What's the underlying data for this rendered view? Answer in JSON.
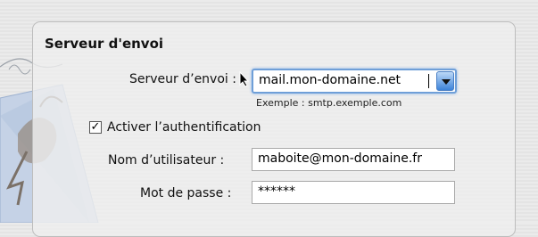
{
  "section": {
    "title": "Serveur d'envoi"
  },
  "outgoing_server": {
    "label": "Serveur d’envoi :",
    "value": "mail.mon-domaine.net",
    "hint": "Exemple : smtp.exemple.com"
  },
  "auth": {
    "checkbox_label": "Activer l’authentification",
    "checked": true,
    "check_mark": "✓"
  },
  "username": {
    "label": "Nom d’utilisateur :",
    "value": "maboite@mon-domaine.fr"
  },
  "password": {
    "label": "Mot de passe :",
    "value": "******"
  },
  "colors": {
    "accent": "#3d83d9",
    "focus_ring": "#6f9fd8"
  }
}
